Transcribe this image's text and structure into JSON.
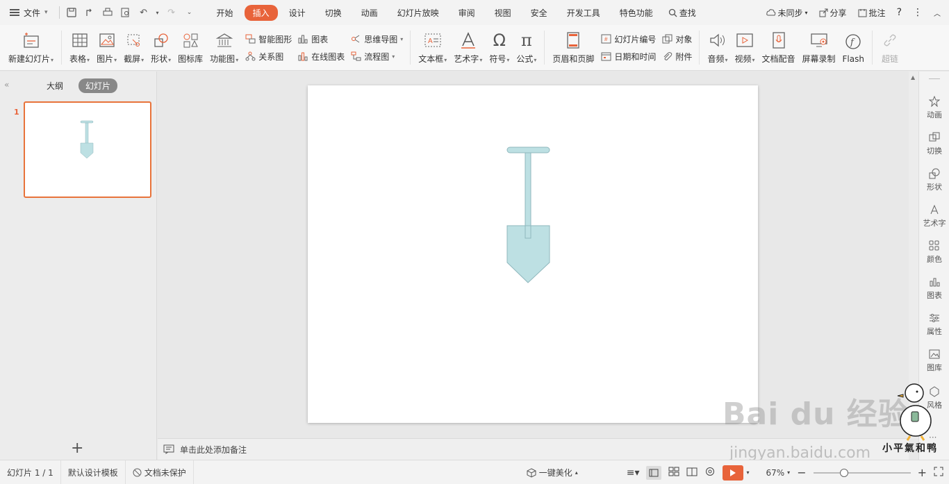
{
  "menubar": {
    "file_label": "文件",
    "tabs": [
      "开始",
      "插入",
      "设计",
      "切换",
      "动画",
      "幻灯片放映",
      "审阅",
      "视图",
      "安全",
      "开发工具",
      "特色功能"
    ],
    "active_tab": "插入",
    "search_label": "查找",
    "sync_label": "未同步",
    "share_label": "分享",
    "comment_label": "批注"
  },
  "ribbon": {
    "new_slide": "新建幻灯片",
    "table": "表格",
    "picture": "图片",
    "screenshot": "截屏",
    "shape": "形状",
    "icon_lib": "图标库",
    "func_chart": "功能图",
    "smart_shape": "智能图形",
    "chart": "图表",
    "relation": "关系图",
    "online_chart": "在线图表",
    "mindmap": "思维导图",
    "flowchart": "流程图",
    "textbox": "文本框",
    "wordart": "艺术字",
    "symbol": "符号",
    "formula": "公式",
    "header_footer": "页眉和页脚",
    "slide_number": "幻灯片编号",
    "datetime": "日期和时间",
    "object": "对象",
    "attachment": "附件",
    "audio": "音频",
    "video": "视频",
    "voiceover": "文档配音",
    "screen_record": "屏幕录制",
    "flash": "Flash",
    "hyperlink": "超链"
  },
  "left_panel": {
    "tab_outline": "大纲",
    "tab_slides": "幻灯片",
    "slide_number": "1"
  },
  "notes": {
    "placeholder": "单击此处添加备注"
  },
  "right_panel": [
    "动画",
    "切换",
    "形状",
    "艺术字",
    "颜色",
    "图表",
    "属性",
    "图库",
    "风格"
  ],
  "status": {
    "slide_info": "幻灯片 1 / 1",
    "template": "默认设计模板",
    "protection": "文档未保护",
    "beautify": "一键美化",
    "zoom": "67%",
    "zoom_fraction": 0.3
  },
  "watermark": {
    "brand": "Bai du 经验",
    "url": "jingyan.baidu.com",
    "signature": "小平氣和鸭"
  },
  "colors": {
    "accent": "#e8633a",
    "shape_fill": "#bde0e3",
    "shape_stroke": "#8fb7bd"
  }
}
